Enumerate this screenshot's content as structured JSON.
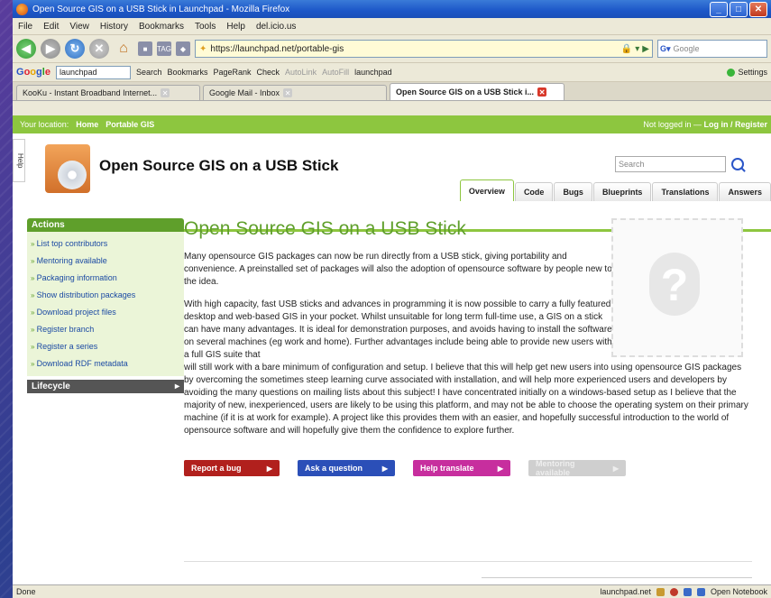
{
  "window": {
    "title": "Open Source GIS on a USB Stick in Launchpad - Mozilla Firefox",
    "min": "_",
    "max": "□",
    "close": "✕"
  },
  "menu": [
    "File",
    "Edit",
    "View",
    "History",
    "Bookmarks",
    "Tools",
    "Help",
    "del.icio.us"
  ],
  "nav": {
    "url": "https://launchpad.net/portable-gis",
    "search_placeholder": "Google"
  },
  "google_toolbar": {
    "query": "launchpad",
    "search": "Search",
    "bookmarks": "Bookmarks",
    "pagerank": "PageRank",
    "check": "Check",
    "autolink": "AutoLink",
    "autofill": "AutoFill",
    "launchpad": "launchpad",
    "settings": "Settings"
  },
  "tabs": [
    {
      "label": "KooKu - Instant Broadband Internet..."
    },
    {
      "label": "Google Mail - Inbox"
    },
    {
      "label": "Open Source GIS on a USB Stick i..."
    }
  ],
  "location": {
    "label": "Your location:",
    "home": "Home",
    "crumb": "Portable GIS",
    "not_logged": "Not logged in —",
    "login": "Log in / Register"
  },
  "help_tab": "Help",
  "project": {
    "title": "Open Source GIS on a USB Stick",
    "search_placeholder": "Search"
  },
  "project_tabs": [
    "Overview",
    "Code",
    "Bugs",
    "Blueprints",
    "Translations",
    "Answers"
  ],
  "sidebar": {
    "actions_title": "Actions",
    "actions": [
      "List top contributors",
      "Mentoring available",
      "Packaging information",
      "Show distribution packages",
      "Download project files",
      "Register branch",
      "Register a series",
      "Download RDF metadata"
    ],
    "lifecycle": "Lifecycle"
  },
  "content": {
    "heading": "Open Source GIS on a USB Stick",
    "p1": "Many opensource GIS packages can now be run directly from a USB stick, giving portability and convenience. A preinstalled set of packages will also the adoption of opensource software by people new to the idea.",
    "p2a": "With high capacity, fast USB sticks and advances in programming it is now possible to carry a fully featured desktop and web-based GIS in your pocket. Whilst unsuitable for long term full-time use, a GIS on a stick can have many advantages. It is ideal for demonstration purposes, and avoids having to install the software on several machines (eg work and home). Further advantages include being able to provide new users with a full GIS suite that",
    "p2b": "will still work with a bare minimum of configuration and setup. I believe that this will help get new users into using opensource GIS packages by overcoming the sometimes steep learning curve associated with installation, and will help more experienced users and developers by avoiding the many questions on mailing lists about this subject! I have concentrated initially on a windows-based setup as I believe that the majority of new, inexperienced, users are likely to be using this platform, and may not be able to choose the operating system on their primary machine (if it is at work for example). A project like this provides them with an easier, and hopefully successful introduction to the world of opensource software and will hopefully give them the confidence to explore further."
  },
  "buttons": {
    "bug": "Report a bug",
    "ask": "Ask a question",
    "translate": "Help translate",
    "mentor": "Mentoring available"
  },
  "status": {
    "left": "Done",
    "domain": "launchpad.net",
    "notebook": "Open Notebook"
  }
}
